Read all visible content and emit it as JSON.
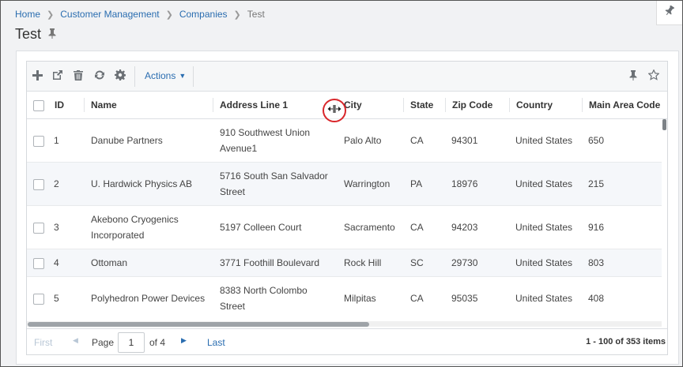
{
  "breadcrumb": {
    "items": [
      "Home",
      "Customer Management",
      "Companies"
    ],
    "current": "Test"
  },
  "page": {
    "title": "Test"
  },
  "toolbar": {
    "actions_label": "Actions"
  },
  "table": {
    "columns": [
      "ID",
      "Name",
      "Address Line 1",
      "City",
      "State",
      "Zip Code",
      "Country",
      "Main Area Code"
    ],
    "rows": [
      {
        "id": "1",
        "name": [
          "Danube Partners"
        ],
        "address": [
          "910 Southwest Union",
          "Avenue1"
        ],
        "city": "Palo Alto",
        "state": "CA",
        "zip": "94301",
        "country": "United States",
        "area": "650"
      },
      {
        "id": "2",
        "name": [
          "U. Hardwick Physics AB"
        ],
        "address": [
          "5716 South San Salvador",
          "Street"
        ],
        "city": "Warrington",
        "state": "PA",
        "zip": "18976",
        "country": "United States",
        "area": "215"
      },
      {
        "id": "3",
        "name": [
          "Akebono Cryogenics",
          "Incorporated"
        ],
        "address": [
          "5197 Colleen Court"
        ],
        "city": "Sacramento",
        "state": "CA",
        "zip": "94203",
        "country": "United States",
        "area": "916"
      },
      {
        "id": "4",
        "name": [
          "Ottoman"
        ],
        "address": [
          "3771 Foothill Boulevard"
        ],
        "city": "Rock Hill",
        "state": "SC",
        "zip": "29730",
        "country": "United States",
        "area": "803"
      },
      {
        "id": "5",
        "name": [
          "Polyhedron Power Devices"
        ],
        "address": [
          "8383 North Colombo",
          "Street"
        ],
        "city": "Milpitas",
        "state": "CA",
        "zip": "95035",
        "country": "United States",
        "area": "408"
      }
    ]
  },
  "pager": {
    "first": "First",
    "page_label": "Page",
    "page_value": "1",
    "of_label": "of 4",
    "last": "Last",
    "summary": "1 - 100 of 353 items"
  },
  "colors": {
    "link": "#2a6db0",
    "icon": "#6b7075",
    "cursor_ring": "#d9262a"
  }
}
